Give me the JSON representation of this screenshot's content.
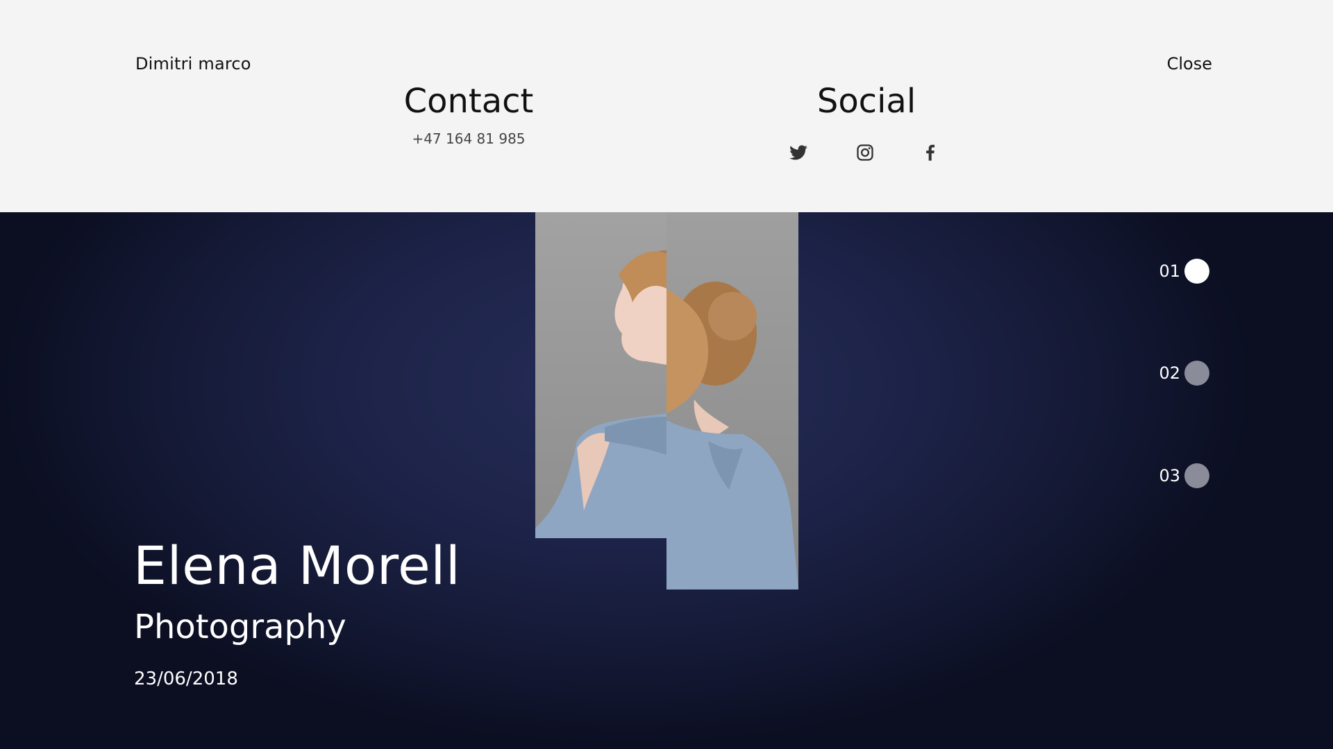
{
  "header": {
    "brand": "Dimitri marco",
    "close_label": "Close"
  },
  "contact": {
    "heading": "Contact",
    "phone": "+47 164 81 985"
  },
  "social": {
    "heading": "Social",
    "icons": [
      "twitter-icon",
      "instagram-icon",
      "facebook-icon"
    ]
  },
  "hero": {
    "name": "Elena Morell",
    "category": "Photography",
    "date": "23/06/2018"
  },
  "pager": {
    "items": [
      {
        "label": "01",
        "active": true
      },
      {
        "label": "02",
        "active": false
      },
      {
        "label": "03",
        "active": false
      }
    ]
  },
  "colors": {
    "panel_bg": "#f4f4f4",
    "hero_bg": "#1d2348",
    "dot_inactive": "#8a8c99",
    "dot_active": "#ffffff"
  }
}
